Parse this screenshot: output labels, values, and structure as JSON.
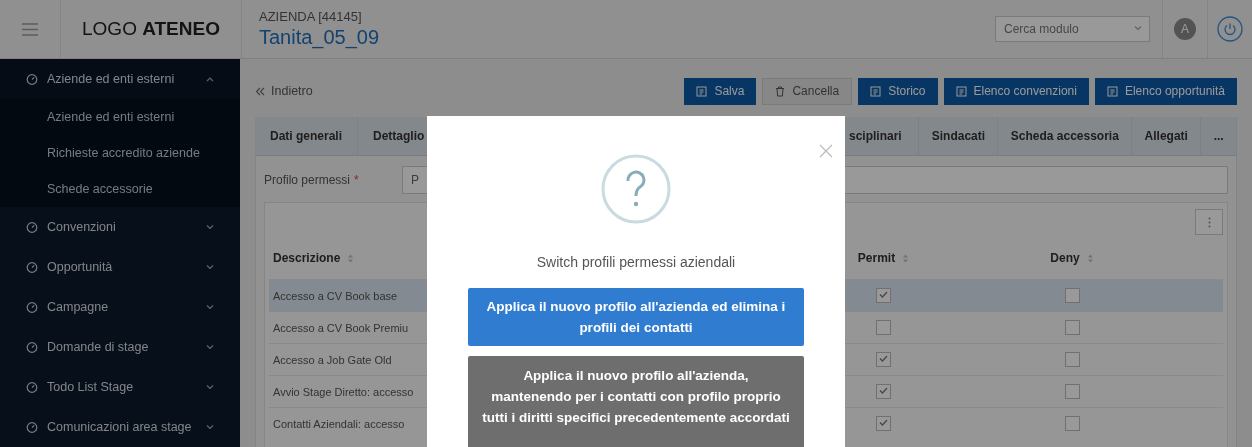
{
  "header": {
    "logo": "LOGO **ATENEO**",
    "company_label": "AZIENDA [44145]",
    "company_name": "Tanita_05_09",
    "search": {
      "placeholder": "Cerca modulo"
    },
    "avatar": "A"
  },
  "sidebar": {
    "items": [
      {
        "label": "Aziende ed enti esterni",
        "expanded": true,
        "children": [
          {
            "label": "Aziende ed enti esterni"
          },
          {
            "label": "Richieste accredito aziende"
          },
          {
            "label": "Schede accessorie"
          }
        ]
      },
      {
        "label": "Convenzioni",
        "expanded": false
      },
      {
        "label": "Opportunità",
        "expanded": false
      },
      {
        "label": "Campagne",
        "expanded": false
      },
      {
        "label": "Domande di stage",
        "expanded": false
      },
      {
        "label": "Todo List Stage",
        "expanded": false
      },
      {
        "label": "Comunicazioni area stage",
        "expanded": false
      }
    ]
  },
  "toolbar": {
    "back": "Indietro",
    "buttons": [
      {
        "label": "Salva",
        "kind": "primary"
      },
      {
        "label": "Cancella",
        "kind": "secondary"
      },
      {
        "label": "Storico",
        "kind": "primary"
      },
      {
        "label": "Elenco convenzioni",
        "kind": "primary"
      },
      {
        "label": "Elenco opportunità",
        "kind": "primary"
      }
    ]
  },
  "tabs_left": [
    {
      "label": "Dati generali"
    },
    {
      "label": "Dettaglio"
    }
  ],
  "tabs_right": [
    {
      "label": "sciplinari"
    },
    {
      "label": "Sindacati"
    },
    {
      "label": "Scheda accessoria"
    },
    {
      "label": "Allegati"
    },
    {
      "label": "..."
    }
  ],
  "form": {
    "label": "Profilo permessi",
    "required_mark": "*",
    "value": "P"
  },
  "table": {
    "columns": [
      "Descrizione",
      "Permit",
      "Deny"
    ],
    "rows": [
      {
        "description": "Accesso a CV Book base",
        "permit": true,
        "deny": false,
        "selected": true
      },
      {
        "description": "Accesso a CV Book Premiu",
        "permit": false,
        "deny": false,
        "selected": false
      },
      {
        "description": "Accesso a Job Gate Old",
        "permit": true,
        "deny": false,
        "selected": false
      },
      {
        "description": "Avvio Stage Diretto: accesso",
        "permit": true,
        "deny": false,
        "selected": false
      },
      {
        "description": "Contatti Aziendali: accesso",
        "permit": true,
        "deny": false,
        "selected": false
      }
    ]
  },
  "modal": {
    "title": "Switch profili permessi aziendali",
    "buttons": [
      {
        "label": "Applica il nuovo profilo all'azienda ed elimina i profili dei contatti",
        "kind": "primary"
      },
      {
        "label": "Applica il nuovo profilo all'azienda, mantenendo per i contatti con profilo proprio tutti i diritti specifici precedentemente accordati",
        "kind": "secondary"
      }
    ]
  }
}
